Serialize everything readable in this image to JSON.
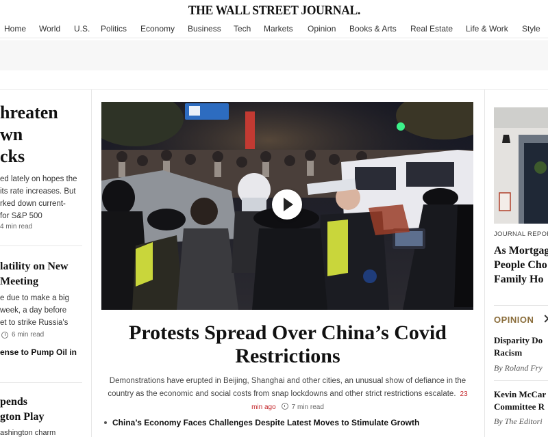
{
  "masthead": {
    "title": "THE WALL STREET JOURNAL."
  },
  "nav": {
    "items": [
      "Home",
      "World",
      "U.S.",
      "Politics",
      "Economy",
      "Business",
      "Tech",
      "Markets",
      "Opinion",
      "Books & Arts",
      "Real Estate",
      "Life & Work",
      "Style"
    ]
  },
  "left": {
    "story1": {
      "headline_lines": [
        "hreaten",
        "wn",
        "cks"
      ],
      "summary_lines": [
        "ed lately on hopes the",
        "its rate increases. But",
        "rked down current-",
        "for S&P 500"
      ],
      "read_time": "4 min read"
    },
    "story2": {
      "headline_lines": [
        "latility on New",
        "Meeting"
      ],
      "summary_lines": [
        "e due to make a big",
        "week, a day before",
        "et to strike Russia's"
      ],
      "read_time": "6 min read"
    },
    "link": "ense to Pump Oil in",
    "story3": {
      "headline_lines": [
        "pends",
        "gton Play"
      ],
      "summary": "ashington charm"
    }
  },
  "center": {
    "hero_alt": "Protest video",
    "headline": "Protests Spread Over China’s Covid Restrictions",
    "summary": "Demonstrations have erupted in Beijing, Shanghai and other cities, an unusual show of defiance in the country as the economic and social costs from snap lockdowns and other strict restrictions escalate.",
    "timestamp": "23 min ago",
    "read_time": "7 min read",
    "related": "China’s Economy Faces Challenges Despite Latest Moves to Stimulate Growth"
  },
  "right": {
    "kicker": "JOURNAL REPORTS",
    "headline_lines": [
      "As Mortgag",
      "People Cho",
      "Family Ho"
    ],
    "section": "OPINION",
    "op1": {
      "title_lines": [
        "Disparity Do",
        "Racism"
      ],
      "byline": "By Roland Fry"
    },
    "op2": {
      "title_lines": [
        "Kevin McCar",
        "Committee R"
      ],
      "byline": "By The Editori"
    }
  },
  "colors": {
    "accent_red": "#c4272b",
    "opinion_gold": "#8a6d3b",
    "rule": "#e6e6e6"
  }
}
